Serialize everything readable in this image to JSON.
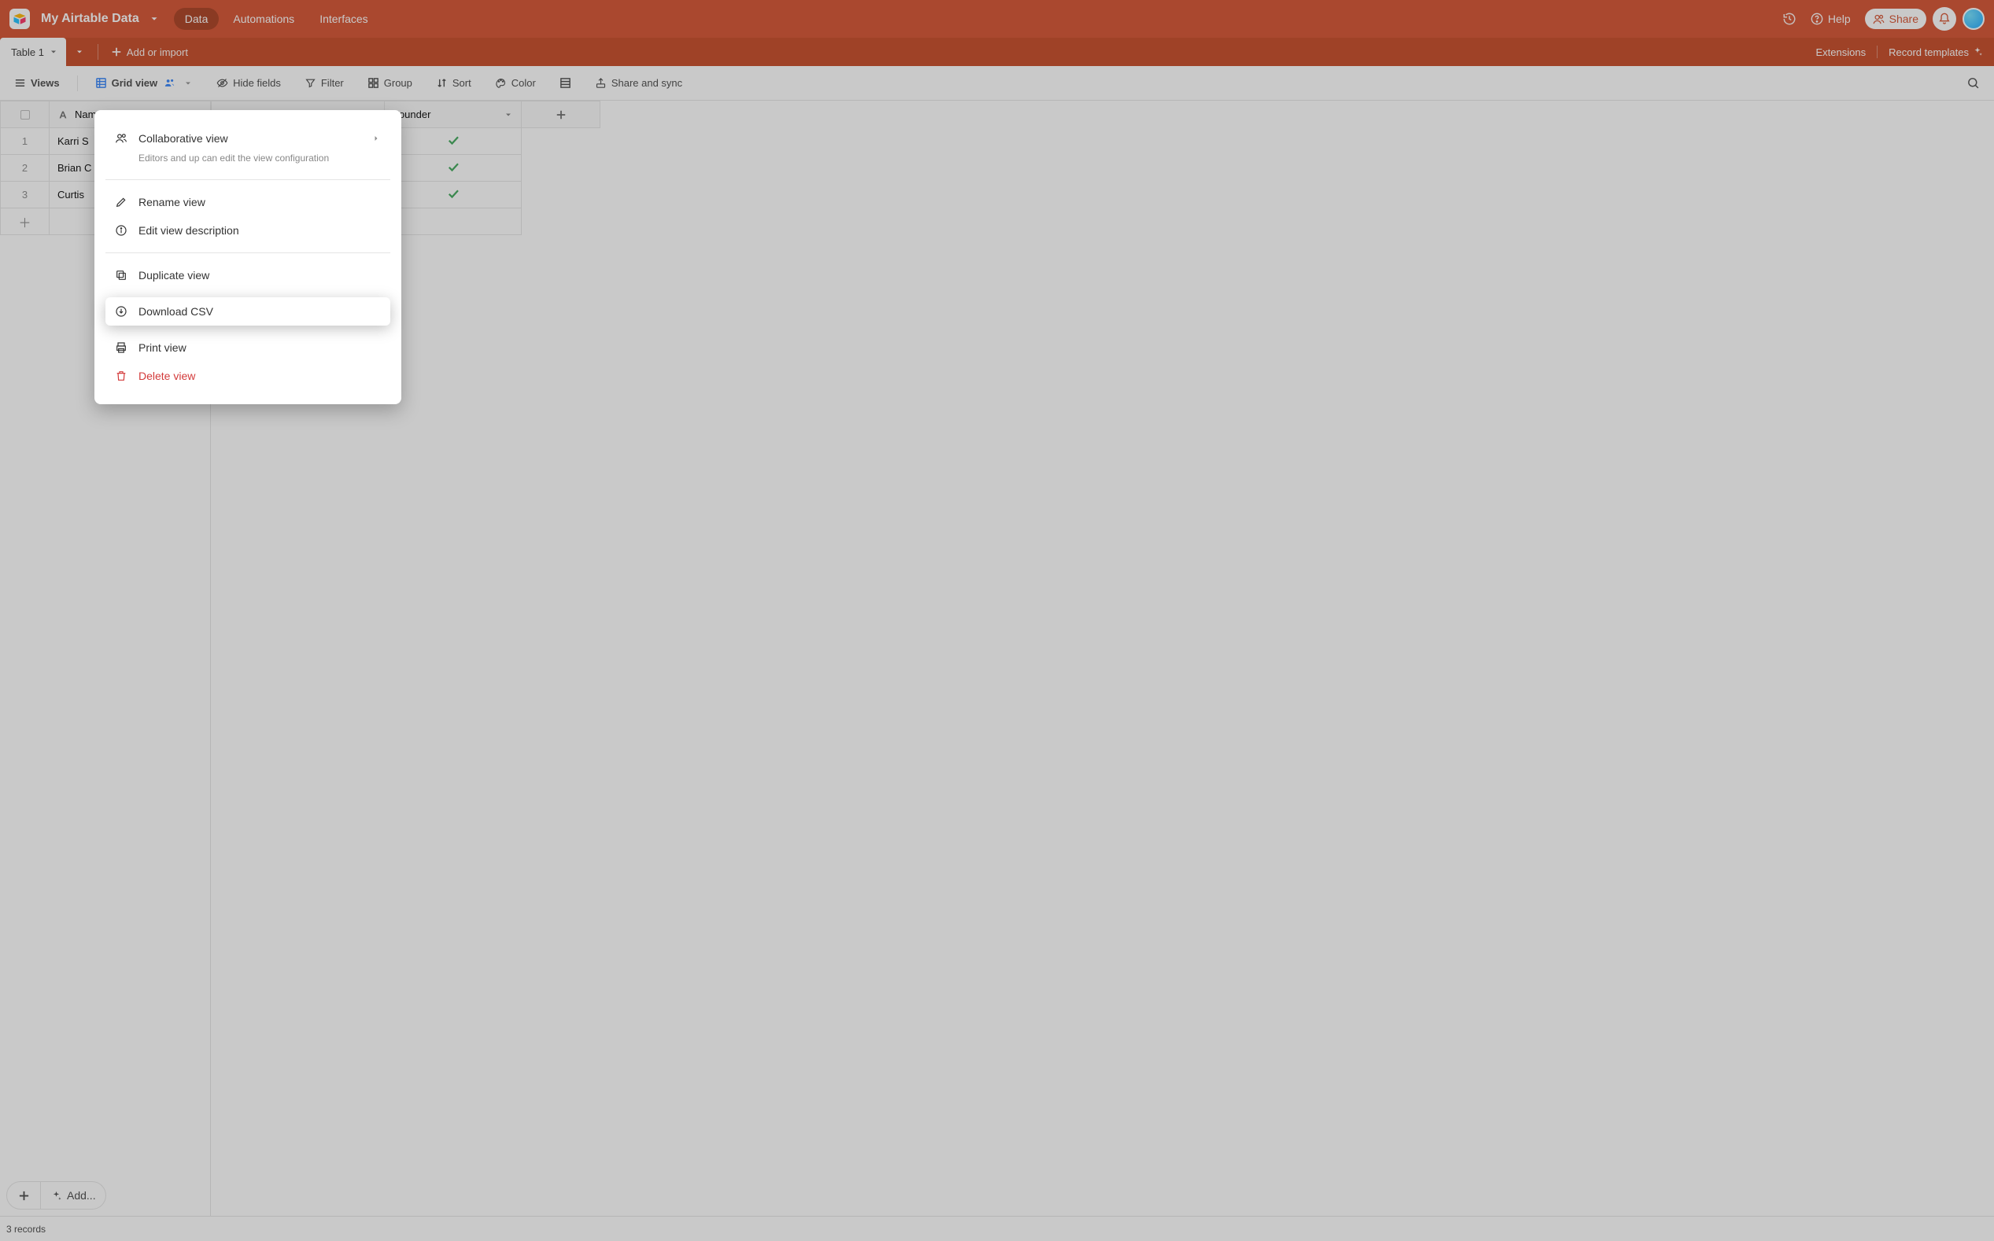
{
  "colors": {
    "brand": "#d54d2a",
    "brand_dark": "#c5441f",
    "brand_darker": "#a83a1a",
    "green": "#3aa655",
    "danger": "#d33a3a"
  },
  "header": {
    "base_name": "My Airtable Data",
    "nav": [
      "Data",
      "Automations",
      "Interfaces"
    ],
    "nav_active_index": 0,
    "help_label": "Help",
    "share_label": "Share"
  },
  "tables_bar": {
    "active_table": "Table 1",
    "add_or_import": "Add or import",
    "extensions": "Extensions",
    "record_templates": "Record templates"
  },
  "toolbar": {
    "views": "Views",
    "grid_view": "Grid view",
    "hide_fields": "Hide fields",
    "filter": "Filter",
    "group": "Group",
    "sort": "Sort",
    "color": "Color",
    "share_sync": "Share and sync"
  },
  "grid": {
    "columns": {
      "name": "Name",
      "founder": "Founder"
    },
    "rows": [
      {
        "n": "1",
        "name": "Karri S",
        "founder": true
      },
      {
        "n": "2",
        "name": "Brian C",
        "founder": true
      },
      {
        "n": "3",
        "name": "Curtis",
        "founder": true
      }
    ]
  },
  "ctx_menu": {
    "collaborative": "Collaborative view",
    "collaborative_sub": "Editors and up can edit the view configuration",
    "rename": "Rename view",
    "edit_desc": "Edit view description",
    "duplicate": "Duplicate view",
    "download_csv": "Download CSV",
    "print": "Print view",
    "delete": "Delete view"
  },
  "footer": {
    "add_label": "Add...",
    "records": "3 records"
  }
}
